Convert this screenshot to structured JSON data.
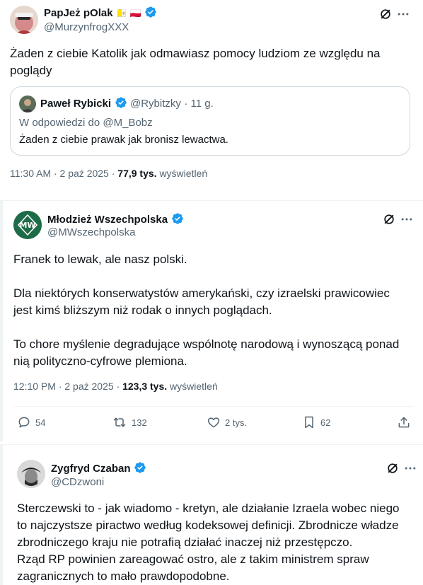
{
  "tweet1": {
    "name": "PapJeż pOlak",
    "flags": "🇻🇦 🇵🇱",
    "handle": "@MurzynfrogXXX",
    "text_line1": "Żaden z ciebie Katolik jak odmawiasz pomocy ludziom ze względu na",
    "text_line2": "poglądy",
    "quote": {
      "name": "Paweł Rybicki",
      "handle": "@Rybitzky",
      "time": "· 11 g.",
      "reply_to": "W odpowiedzi do @M_Bobz",
      "text": "Żaden z ciebie prawak jak bronisz lewactwa."
    },
    "timestamp": "11:30 AM · 2 paź 2025 ·",
    "views_count": "77,9 tys.",
    "views_label": "wyświetleń"
  },
  "tweet2": {
    "name": "Młodzież Wszechpolska",
    "handle": "@MWszechpolska",
    "para1": "Franek to lewak, ale nasz polski.",
    "para2_line1": "Dla niektórych konserwatystów amerykański, czy izraelski prawicowiec",
    "para2_line2": "jest kimś bliższym niż rodak o innych poglądach.",
    "para3_line1": "To chore myślenie degradujące wspólnotę narodową i wynoszącą ponad",
    "para3_line2": "nią polityczno-cyfrowe plemiona.",
    "timestamp": "12:10 PM · 2 paź 2025 ·",
    "views_count": "123,3 tys.",
    "views_label": "wyświetleń",
    "actions": {
      "replies": "54",
      "reposts": "132",
      "likes": "2 tys.",
      "bookmarks": "62"
    }
  },
  "tweet3": {
    "name": "Zygfryd Czaban",
    "handle": "@CDzwoni",
    "line1": "Sterczewski to - jak wiadomo - kretyn, ale działanie Izraela wobec niego",
    "line2": "to najczystsze piractwo według kodeksowej definicji. Zbrodnicze władze",
    "line3": "zbrodniczego kraju nie potrafią działać inaczej niż przestępczo.",
    "line4": "Rząd RP powinien zareagować ostro, ale z takim ministrem spraw",
    "line5": "zagranicznych to mało prawdopodobne."
  },
  "colors": {
    "verified": "#1d9bf0",
    "text": "#0f1419",
    "muted": "#536471",
    "border": "#cfd9de",
    "mw_green": "#1e6b47"
  }
}
